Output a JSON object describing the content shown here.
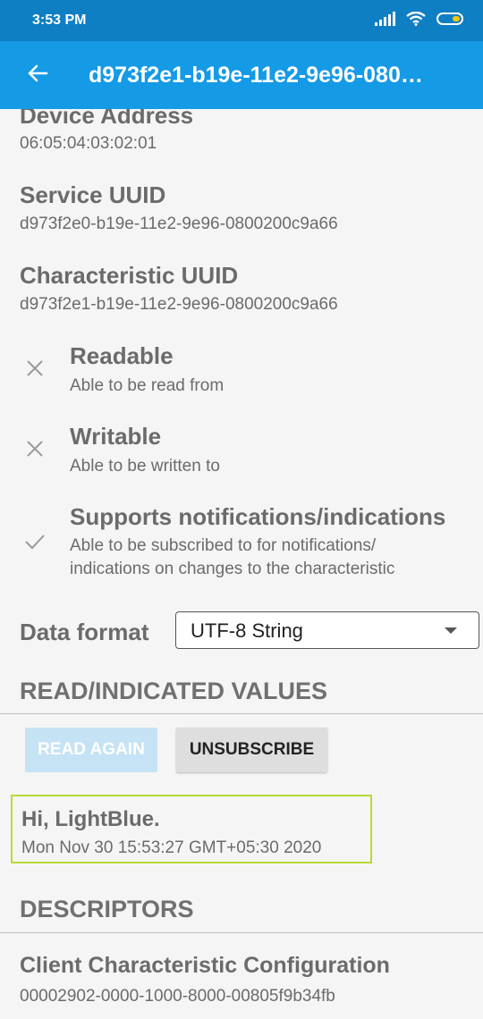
{
  "status_bar": {
    "time": "3:53 PM"
  },
  "toolbar": {
    "back_icon": "arrow-left-icon",
    "title": "d973f2e1-b19e-11e2-9e96-080…"
  },
  "device": {
    "label": "Device Address",
    "value": "06:05:04:03:02:01"
  },
  "service": {
    "label": "Service UUID",
    "value": "d973f2e0-b19e-11e2-9e96-0800200c9a66"
  },
  "characteristic": {
    "label": "Characteristic UUID",
    "value": "d973f2e1-b19e-11e2-9e96-0800200c9a66"
  },
  "properties": [
    {
      "icon": "close-icon",
      "title": "Readable",
      "desc": "Able to be read from"
    },
    {
      "icon": "close-icon",
      "title": "Writable",
      "desc": "Able to be written to"
    },
    {
      "icon": "check-icon",
      "title": "Supports notifications/indications",
      "desc_line1": "Able to be subscribed to for notifications/",
      "desc_line2": "indications on changes to the characteristic"
    }
  ],
  "data_format": {
    "label": "Data format",
    "selected": "UTF-8 String"
  },
  "read_section": {
    "header": "READ/INDICATED VALUES",
    "read_again_label": "READ AGAIN",
    "unsubscribe_label": "UNSUBSCRIBE",
    "value_text": "Hi, LightBlue.",
    "value_time": "Mon Nov 30 15:53:27 GMT+05:30 2020"
  },
  "descriptors": {
    "header": "DESCRIPTORS",
    "items": [
      {
        "title": "Client Characteristic Configuration",
        "uuid": "00002902-0000-1000-8000-00805f9b34fb"
      }
    ]
  },
  "colors": {
    "status_bar": "#0f7fc4",
    "toolbar": "#159ae6",
    "highlight_border": "#b8da33",
    "disabled_button": "#c5e3f4"
  }
}
